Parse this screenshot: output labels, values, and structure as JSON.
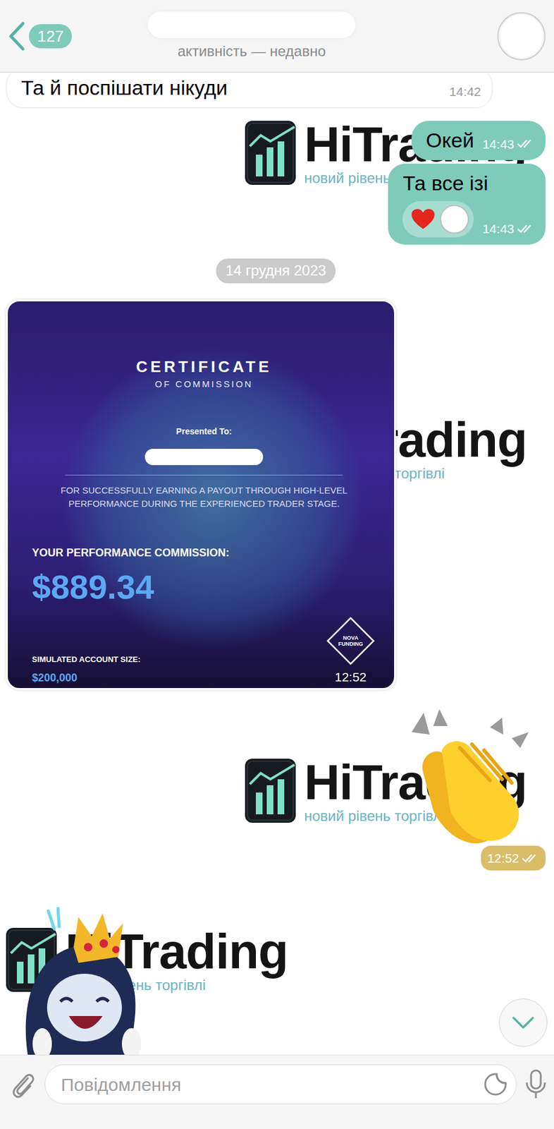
{
  "header": {
    "back_badge": "127",
    "status": "активність — недавно"
  },
  "wallpaper": {
    "brand": "HiTrading",
    "tagline": "новий рівень торгівлі"
  },
  "messages": [
    {
      "kind": "text",
      "outgoing": false,
      "text": "Та й поспішати нікуди",
      "time": "14:42"
    },
    {
      "kind": "text",
      "outgoing": true,
      "text": "Окей",
      "time": "14:43",
      "read": true
    },
    {
      "kind": "text",
      "outgoing": true,
      "text": "Та все ізі",
      "time": "14:43",
      "read": true,
      "reactions": [
        {
          "mine": false
        }
      ]
    },
    {
      "kind": "date",
      "text": "14 грудня 2023"
    },
    {
      "kind": "certificate",
      "outgoing": false,
      "time": "12:52",
      "title": "CERTIFICATE",
      "subtitle": "OF COMMISSION",
      "presented": "Presented To:",
      "description": "FOR SUCCESSFULLY EARNING A PAYOUT THROUGH HIGH-LEVEL PERFORMANCE DURING THE EXPERIENCED TRADER STAGE.",
      "commission_label": "YOUR PERFORMANCE COMMISSION:",
      "commission": "$889.34",
      "size_label": "SIMULATED ACCOUNT SIZE:",
      "size": "$200,000",
      "logo_lines": [
        "NOVA",
        "FUNDING"
      ]
    },
    {
      "kind": "sticker",
      "outgoing": true,
      "time": "12:52",
      "read": true
    },
    {
      "kind": "sticker",
      "outgoing": false
    }
  ],
  "input": {
    "placeholder": "Повідомлення"
  }
}
